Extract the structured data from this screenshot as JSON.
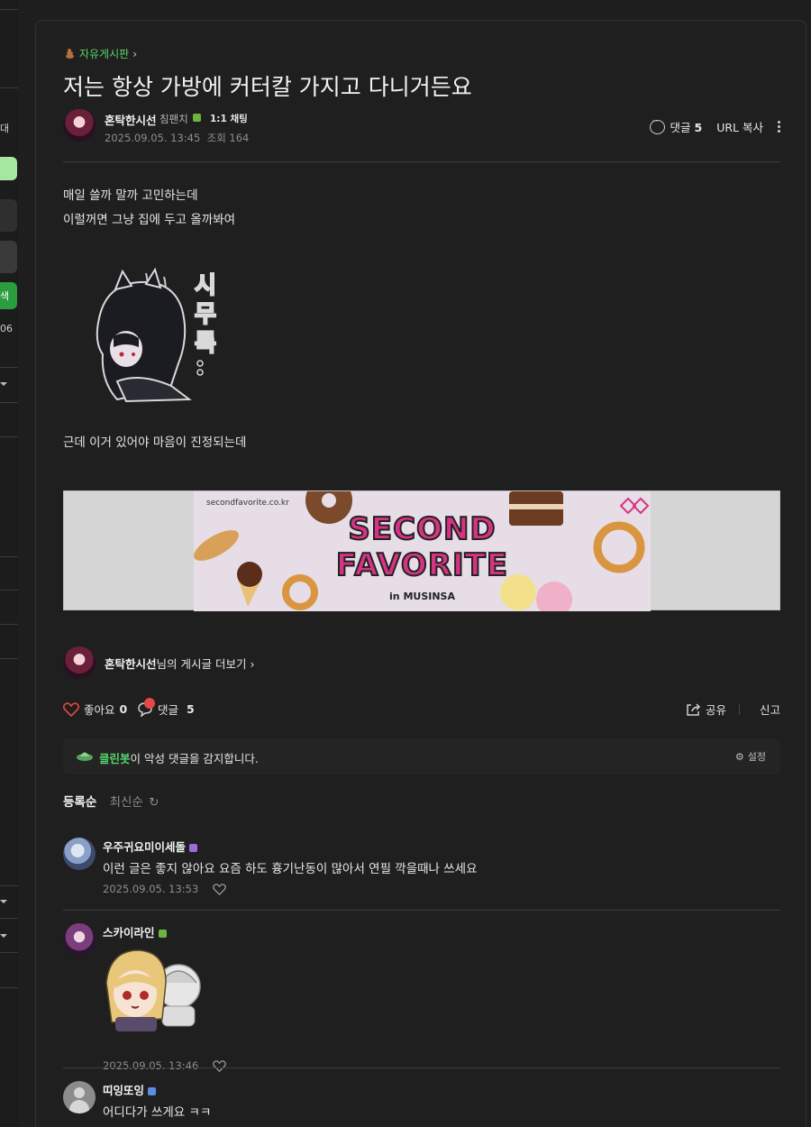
{
  "sidebar": {
    "frag1": "대",
    "frag2": "색",
    "frag3": "06"
  },
  "post": {
    "board_name": "자유게시판",
    "title": "저는 항상 가방에 커터칼 가지고 다니거든요",
    "author": {
      "name": "혼탁한시선",
      "level": "침팬치",
      "chat_label": "1:1 채팅"
    },
    "date": "2025.09.05. 13:45",
    "views": "조회 164",
    "comment_label": "댓글",
    "comment_count": "5",
    "url_copy": "URL 복사",
    "body_lines": [
      "매일 쓸까 말까 고민하는데",
      "이럴꺼면 그냥 집에 두고 올까봐여",
      "근데 이거 있어야 마음이 진정되는데"
    ],
    "sticker_text": "시무룩..",
    "banner": {
      "url": "secondfavorite.co.kr",
      "line1": "SECOND",
      "line2": "FAVORITE",
      "sub": "in MUSINSA"
    },
    "more_posts_name": "혼탁한시선",
    "more_posts_suffix": "님의 게시글 더보기",
    "like_label": "좋아요",
    "like_count": "0",
    "reply_label": "댓글",
    "reply_count": "5",
    "share_label": "공유",
    "report_label": "신고"
  },
  "cleanbot": {
    "name": "클린봇",
    "message": "이 악성 댓글을 감지합니다.",
    "settings": "설정"
  },
  "sort": {
    "active": "등록순",
    "inactive": "최신순"
  },
  "comments": [
    {
      "name": "우주귀요미이세돌",
      "text": "이런 글은 좋지 않아요 요즘 하도 흉기난동이 많아서 연필 깍을때나 쓰세요",
      "date": "2025.09.05. 13:53"
    },
    {
      "name": "스카이라인",
      "text": "",
      "date": "2025.09.05. 13:46"
    },
    {
      "name": "띠잉또잉",
      "text": "어디다가 쓰게요 ㅋㅋ",
      "date": ""
    }
  ],
  "colors": {
    "accent_green": "#57d56a",
    "background": "#1e1e1e",
    "like_heart": "#e54848"
  }
}
